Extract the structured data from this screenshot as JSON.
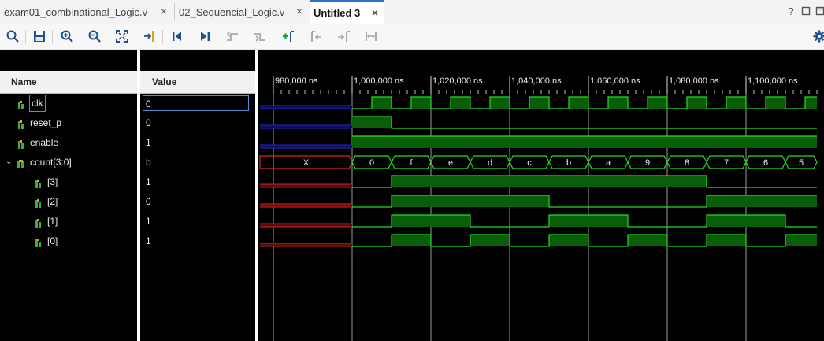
{
  "tabs": [
    {
      "label": "exam01_combinational_Logic.v",
      "active": false
    },
    {
      "label": "02_Sequencial_Logic.v",
      "active": false
    },
    {
      "label": "Untitled 3",
      "active": true
    }
  ],
  "window_controls": {
    "help": "?",
    "restore": "□",
    "maximize": "□"
  },
  "toolbar": {
    "buttons": [
      "search-icon",
      "save-icon",
      "zoom-in-icon",
      "zoom-out-icon",
      "zoom-fit-icon",
      "go-to-cursor-icon",
      "go-to-time-zero-icon",
      "go-to-last-time-icon",
      "previous-transition-icon",
      "next-transition-icon",
      "add-marker-icon",
      "previous-marker-icon",
      "next-marker-icon",
      "swap-cursors-icon",
      "settings-gear-icon"
    ]
  },
  "names_pane": {
    "header": "Name"
  },
  "values_pane": {
    "header": "Value"
  },
  "signals": [
    {
      "name": "clk",
      "value": "0",
      "kind": "bit",
      "expanded": null,
      "indent": 0,
      "selected": true
    },
    {
      "name": "reset_p",
      "value": "0",
      "kind": "bit",
      "expanded": null,
      "indent": 0
    },
    {
      "name": "enable",
      "value": "1",
      "kind": "bit",
      "expanded": null,
      "indent": 0
    },
    {
      "name": "count[3:0]",
      "value": "b",
      "kind": "bus",
      "expanded": true,
      "indent": 0
    },
    {
      "name": "[3]",
      "value": "1",
      "kind": "bit",
      "expanded": null,
      "indent": 1
    },
    {
      "name": "[2]",
      "value": "0",
      "kind": "bit",
      "expanded": null,
      "indent": 1
    },
    {
      "name": "[1]",
      "value": "1",
      "kind": "bit",
      "expanded": null,
      "indent": 1
    },
    {
      "name": "[0]",
      "value": "1",
      "kind": "bit",
      "expanded": null,
      "indent": 1
    }
  ],
  "timeline": {
    "unit": "ns",
    "tick_labels": [
      "980,000 ns",
      "1,000,000 ns",
      "1,020,000 ns",
      "1,040,000 ns",
      "1,060,000 ns",
      "1,080,000 ns",
      "1,100,000 ns"
    ],
    "tick_times": [
      980000,
      1000000,
      1020000,
      1040000,
      1060000,
      1080000,
      1100000
    ],
    "view_start": 976000,
    "view_end": 1118000,
    "undefined_until": 1000000
  },
  "waveforms": {
    "clk": {
      "period": 10000,
      "first_rise": 1005000
    },
    "reset_p": {
      "pulses": [
        [
          1000000,
          1010000
        ]
      ]
    },
    "enable": {
      "pulses": [
        [
          1000000,
          1118000
        ]
      ]
    },
    "count": {
      "segments": [
        {
          "start": 976000,
          "end": 1000000,
          "value": "X"
        },
        {
          "start": 1000000,
          "end": 1010000,
          "value": "0"
        },
        {
          "start": 1010000,
          "end": 1020000,
          "value": "f"
        },
        {
          "start": 1020000,
          "end": 1030000,
          "value": "e"
        },
        {
          "start": 1030000,
          "end": 1040000,
          "value": "d"
        },
        {
          "start": 1040000,
          "end": 1050000,
          "value": "c"
        },
        {
          "start": 1050000,
          "end": 1060000,
          "value": "b"
        },
        {
          "start": 1060000,
          "end": 1070000,
          "value": "a"
        },
        {
          "start": 1070000,
          "end": 1080000,
          "value": "9"
        },
        {
          "start": 1080000,
          "end": 1090000,
          "value": "8"
        },
        {
          "start": 1090000,
          "end": 1100000,
          "value": "7"
        },
        {
          "start": 1100000,
          "end": 1110000,
          "value": "6"
        },
        {
          "start": 1110000,
          "end": 1118000,
          "value": "5"
        }
      ]
    }
  },
  "colors": {
    "wave_green": "#22dd22",
    "wave_fill": "#0a5e0a",
    "undefined_red": "#d42424",
    "undefined_fill": "#5a0d0d",
    "z_blue": "#2626d6",
    "z_fill": "#0d0d5a",
    "grid": "#9a9a9a",
    "accent": "#2c6fcf"
  }
}
